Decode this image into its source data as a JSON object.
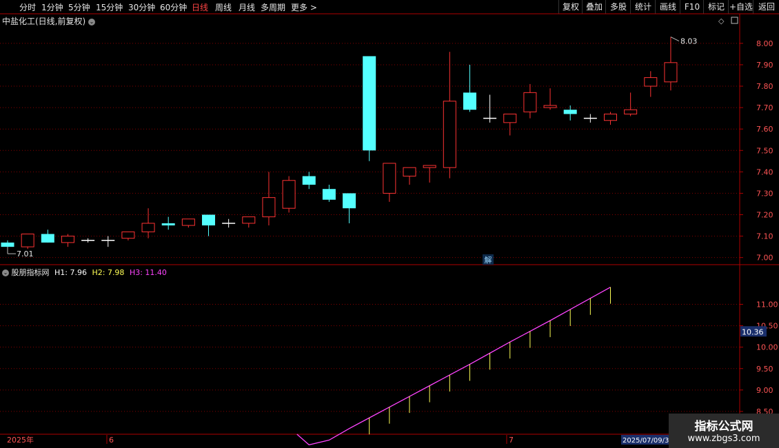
{
  "toolbar": {
    "periods": [
      "分时",
      "1分钟",
      "5分钟",
      "15分钟",
      "30分钟",
      "60分钟",
      "日线",
      "周线",
      "月线",
      "多周期",
      "更多 >"
    ],
    "active_period": "日线",
    "actions": [
      "复权",
      "叠加",
      "多股",
      "统计",
      "画线",
      "F10",
      "标记",
      "+自选",
      "返回"
    ]
  },
  "main_chart": {
    "title": "中盐化工(日线,前复权)",
    "high_label": "8.03",
    "low_label": "7.01",
    "y_ticks": [
      "8.00",
      "7.90",
      "7.80",
      "7.70",
      "7.60",
      "7.50",
      "7.40",
      "7.30",
      "7.20",
      "7.10",
      "7.00"
    ],
    "annotation": "解"
  },
  "indicator": {
    "name": "股朋指标网",
    "h1": "H1: 7.96",
    "h2": "H2: 7.98",
    "h3": "H3: 11.40",
    "y_ticks": [
      "11.00",
      "10.50",
      "10.00",
      "9.50",
      "9.00",
      "8.50"
    ],
    "current_value": "10.36"
  },
  "time_axis": {
    "labels": [
      "2025年",
      "6",
      "7"
    ],
    "cursor_date": "2025/07/09/3"
  },
  "watermark": {
    "line1": "指标公式网",
    "line2": "www.zbgs3.com"
  },
  "colors": {
    "up": "#ff3333",
    "down": "#54ffff",
    "grid": "#8b0000",
    "axis": "#b00000",
    "h1": "#ffffff",
    "h2": "#ffff55",
    "h3": "#ff44ff"
  },
  "chart_data": [
    {
      "type": "candlestick",
      "title": "中盐化工(日线,前复权)",
      "ylim": [
        6.97,
        8.08
      ],
      "candles": [
        {
          "o": 7.07,
          "h": 7.08,
          "l": 7.05,
          "c": 7.05
        },
        {
          "o": 7.05,
          "h": 7.11,
          "l": 7.04,
          "c": 7.11
        },
        {
          "o": 7.11,
          "h": 7.13,
          "l": 7.07,
          "c": 7.07
        },
        {
          "o": 7.07,
          "h": 7.11,
          "l": 7.05,
          "c": 7.1
        },
        {
          "o": 7.08,
          "h": 7.09,
          "l": 7.07,
          "c": 7.08
        },
        {
          "o": 7.08,
          "h": 7.1,
          "l": 7.05,
          "c": 7.08
        },
        {
          "o": 7.09,
          "h": 7.12,
          "l": 7.08,
          "c": 7.12
        },
        {
          "o": 7.12,
          "h": 7.23,
          "l": 7.09,
          "c": 7.16
        },
        {
          "o": 7.16,
          "h": 7.19,
          "l": 7.13,
          "c": 7.15
        },
        {
          "o": 7.15,
          "h": 7.18,
          "l": 7.14,
          "c": 7.18
        },
        {
          "o": 7.2,
          "h": 7.2,
          "l": 7.1,
          "c": 7.15
        },
        {
          "o": 7.16,
          "h": 7.18,
          "l": 7.14,
          "c": 7.16
        },
        {
          "o": 7.16,
          "h": 7.19,
          "l": 7.14,
          "c": 7.19
        },
        {
          "o": 7.19,
          "h": 7.4,
          "l": 7.15,
          "c": 7.28
        },
        {
          "o": 7.23,
          "h": 7.38,
          "l": 7.21,
          "c": 7.36
        },
        {
          "o": 7.38,
          "h": 7.4,
          "l": 7.32,
          "c": 7.34
        },
        {
          "o": 7.32,
          "h": 7.34,
          "l": 7.26,
          "c": 7.27
        },
        {
          "o": 7.3,
          "h": 7.3,
          "l": 7.16,
          "c": 7.23
        },
        {
          "o": 7.94,
          "h": 7.94,
          "l": 7.45,
          "c": 7.5
        },
        {
          "o": 7.3,
          "h": 7.44,
          "l": 7.26,
          "c": 7.44
        },
        {
          "o": 7.38,
          "h": 7.42,
          "l": 7.34,
          "c": 7.42
        },
        {
          "o": 7.42,
          "h": 7.43,
          "l": 7.35,
          "c": 7.43
        },
        {
          "o": 7.42,
          "h": 7.96,
          "l": 7.37,
          "c": 7.73
        },
        {
          "o": 7.77,
          "h": 7.9,
          "l": 7.68,
          "c": 7.69
        },
        {
          "o": 7.65,
          "h": 7.76,
          "l": 7.63,
          "c": 7.65
        },
        {
          "o": 7.63,
          "h": 7.67,
          "l": 7.57,
          "c": 7.67
        },
        {
          "o": 7.68,
          "h": 7.81,
          "l": 7.65,
          "c": 7.77
        },
        {
          "o": 7.7,
          "h": 7.79,
          "l": 7.69,
          "c": 7.71
        },
        {
          "o": 7.69,
          "h": 7.71,
          "l": 7.64,
          "c": 7.67
        },
        {
          "o": 7.65,
          "h": 7.67,
          "l": 7.63,
          "c": 7.65
        },
        {
          "o": 7.64,
          "h": 7.68,
          "l": 7.62,
          "c": 7.67
        },
        {
          "o": 7.67,
          "h": 7.77,
          "l": 7.66,
          "c": 7.69
        },
        {
          "o": 7.8,
          "h": 7.87,
          "l": 7.75,
          "c": 7.84
        },
        {
          "o": 7.82,
          "h": 8.03,
          "l": 7.78,
          "c": 7.91
        }
      ]
    },
    {
      "type": "line",
      "title": "股朋指标网",
      "ylim": [
        8.0,
        11.7
      ],
      "x_start_index": 15,
      "series": [
        {
          "name": "H3",
          "values": [
            7.72,
            7.83,
            8.1,
            8.35,
            8.6,
            8.85,
            9.1,
            9.35,
            9.6,
            9.86,
            10.12,
            10.37,
            10.62,
            10.88,
            11.14,
            11.4
          ]
        }
      ],
      "h1_series": [
        7.71,
        7.7,
        7.71,
        7.72,
        7.73,
        7.74,
        7.75,
        7.77,
        7.78,
        7.8,
        7.82,
        7.84,
        7.88,
        7.92,
        7.94,
        7.96
      ],
      "h2_series": [
        7.72,
        7.73,
        7.74,
        7.75,
        7.76,
        7.77,
        7.78,
        7.8,
        7.82,
        7.84,
        7.86,
        7.88,
        7.91,
        7.94,
        7.96,
        7.98
      ]
    }
  ]
}
